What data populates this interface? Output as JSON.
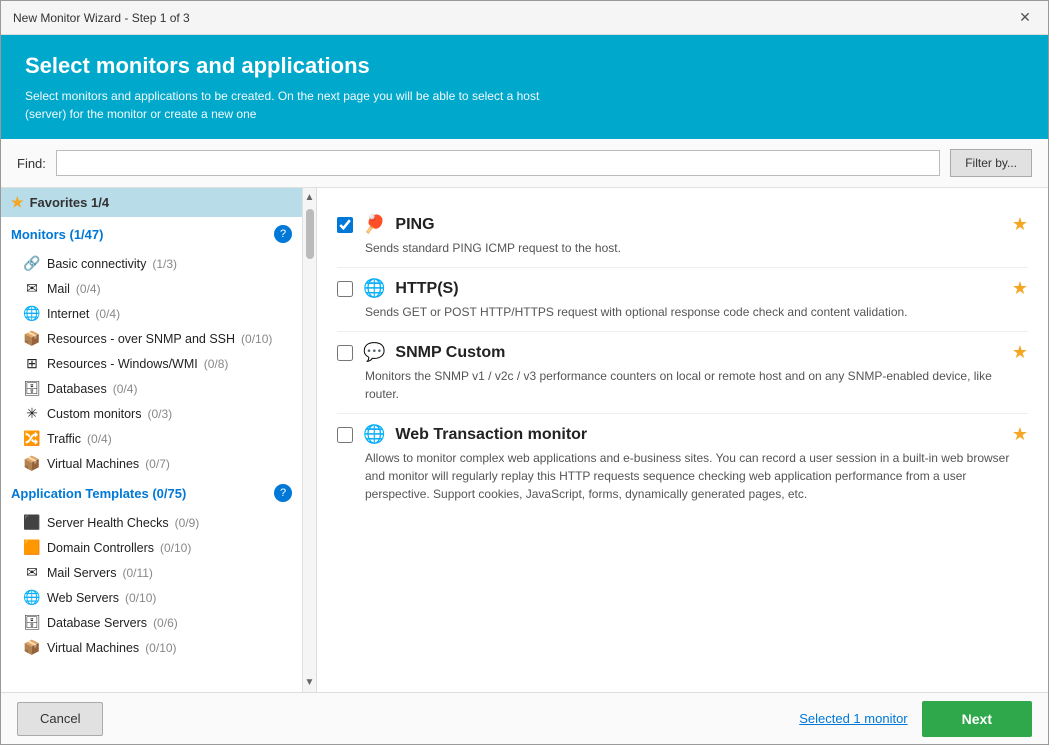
{
  "window": {
    "title": "New Monitor Wizard - Step 1 of 3",
    "close_label": "✕"
  },
  "header": {
    "title": "Select monitors and applications",
    "description": "Select monitors and applications to be created. On the next page you will be able to select\na host (server) for the monitor or create a new one"
  },
  "find_bar": {
    "label": "Find:",
    "placeholder": "",
    "filter_button": "Filter by..."
  },
  "sidebar": {
    "favorites": {
      "label": "Favorites 1/4"
    },
    "monitors_section": {
      "label": "Monitors (1/47)",
      "help": "?"
    },
    "monitors_items": [
      {
        "icon": "🔗",
        "label": "Basic connectivity",
        "count": "(1/3)"
      },
      {
        "icon": "✉",
        "label": "Mail",
        "count": "(0/4)"
      },
      {
        "icon": "🌐",
        "label": "Internet",
        "count": "(0/4)"
      },
      {
        "icon": "📦",
        "label": "Resources - over SNMP and SSH",
        "count": "(0/10)"
      },
      {
        "icon": "⊞",
        "label": "Resources - Windows/WMI",
        "count": "(0/8)"
      },
      {
        "icon": "🗄",
        "label": "Databases",
        "count": "(0/4)"
      },
      {
        "icon": "✳",
        "label": "Custom monitors",
        "count": "(0/3)"
      },
      {
        "icon": "🔀",
        "label": "Traffic",
        "count": "(0/4)"
      },
      {
        "icon": "📦",
        "label": "Virtual Machines",
        "count": "(0/7)"
      }
    ],
    "app_templates_section": {
      "label": "Application Templates (0/75)",
      "help": "?"
    },
    "app_templates_items": [
      {
        "icon": "🔴",
        "label": "Server Health Checks",
        "count": "(0/9)"
      },
      {
        "icon": "🟧",
        "label": "Domain Controllers",
        "count": "(0/10)"
      },
      {
        "icon": "✉",
        "label": "Mail Servers",
        "count": "(0/11)"
      },
      {
        "icon": "🌐",
        "label": "Web Servers",
        "count": "(0/10)"
      },
      {
        "icon": "🗄",
        "label": "Database Servers",
        "count": "(0/6)"
      },
      {
        "icon": "📦",
        "label": "Virtual Machines",
        "count": "(0/10)"
      }
    ]
  },
  "monitors": [
    {
      "id": "ping",
      "checked": true,
      "icon": "🏓",
      "name": "PING",
      "description": "Sends standard PING ICMP request to the host.",
      "starred": true
    },
    {
      "id": "https",
      "checked": false,
      "icon": "🌐",
      "name": "HTTP(S)",
      "description": "Sends GET or POST HTTP/HTTPS request with optional response code check and content validation.",
      "starred": true
    },
    {
      "id": "snmp_custom",
      "checked": false,
      "icon": "💬",
      "name": "SNMP Custom",
      "description": "Monitors the SNMP v1 / v2c / v3 performance counters on local or remote host and on any SNMP-enabled device, like router.",
      "starred": true
    },
    {
      "id": "web_transaction",
      "checked": false,
      "icon": "🌐",
      "name": "Web Transaction monitor",
      "description": "Allows to monitor complex web applications and e-business sites. You can record a user session in a built-in web browser and monitor will regularly replay this HTTP requests sequence checking web application performance from a user perspective. Support cookies, JavaScript, forms, dynamically generated pages, etc.",
      "starred": true
    }
  ],
  "footer": {
    "cancel_label": "Cancel",
    "selected_label": "Selected 1 monitor",
    "next_label": "Next"
  }
}
